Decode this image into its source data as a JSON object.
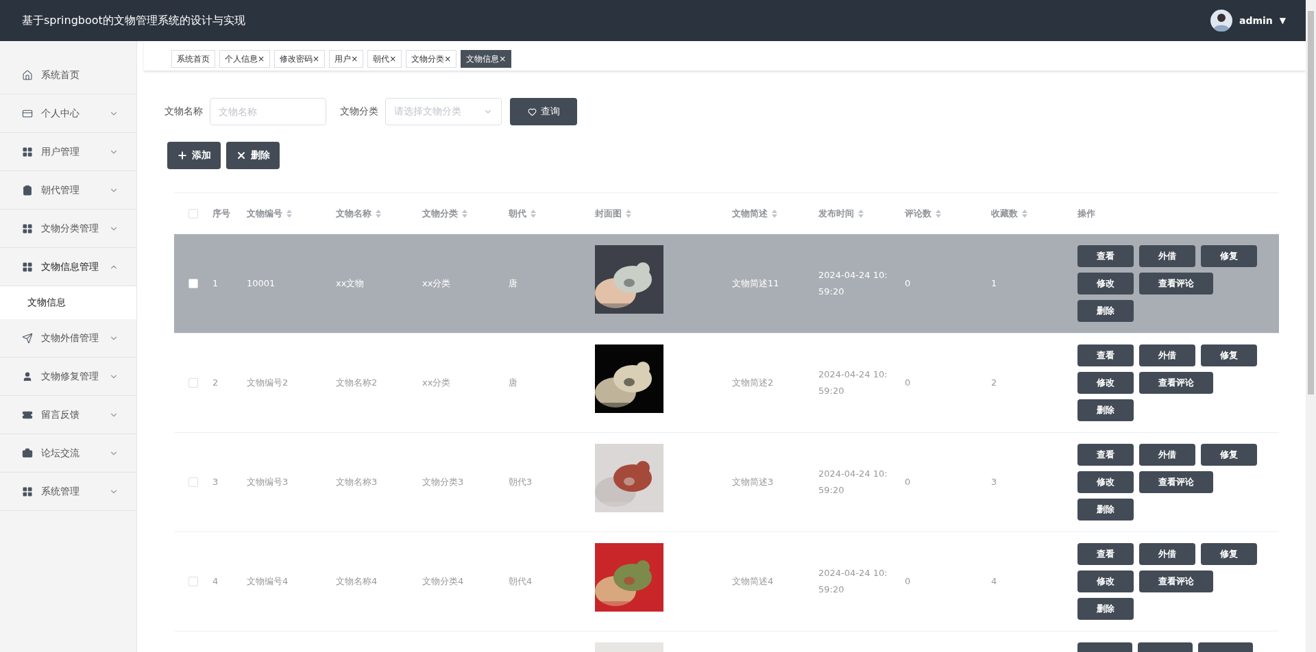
{
  "header": {
    "title": "基于springboot的文物管理系统的设计与实现",
    "user": "admin",
    "caret": "▼"
  },
  "sidebar": {
    "items": [
      {
        "label": "系统首页",
        "kind": "link"
      },
      {
        "label": "个人中心",
        "kind": "menu",
        "expanded": false
      },
      {
        "label": "用户管理",
        "kind": "menu",
        "expanded": false
      },
      {
        "label": "朝代管理",
        "kind": "menu",
        "expanded": false
      },
      {
        "label": "文物分类管理",
        "kind": "menu",
        "expanded": false
      },
      {
        "label": "文物信息管理",
        "kind": "menu",
        "expanded": true,
        "children": [
          {
            "label": "文物信息",
            "selected": true
          }
        ]
      },
      {
        "label": "文物外借管理",
        "kind": "menu",
        "expanded": false
      },
      {
        "label": "文物修复管理",
        "kind": "menu",
        "expanded": false
      },
      {
        "label": "留言反馈",
        "kind": "menu",
        "expanded": false
      },
      {
        "label": "论坛交流",
        "kind": "menu",
        "expanded": false
      },
      {
        "label": "系统管理",
        "kind": "menu",
        "expanded": false
      }
    ]
  },
  "tabs": [
    {
      "label": "系统首页",
      "selected": false
    },
    {
      "label": "个人信息",
      "close": "×",
      "selected": false
    },
    {
      "label": "修改密码",
      "close": "×",
      "selected": false
    },
    {
      "label": "用户",
      "close": "×",
      "selected": false
    },
    {
      "label": "朝代",
      "close": "×",
      "selected": false
    },
    {
      "label": "文物分类",
      "close": "×",
      "selected": false
    },
    {
      "label": "文物信息",
      "close": "×",
      "selected": true
    }
  ],
  "search": {
    "fields": [
      {
        "label": "文物名称",
        "kind": "text",
        "placeholder": "文物名称"
      },
      {
        "label": "文物分类",
        "kind": "select",
        "placeholder": "请选择文物分类"
      }
    ],
    "button": "查询"
  },
  "toolbar": [
    {
      "label": "添加",
      "kind": "add"
    },
    {
      "label": "删除",
      "kind": "delete"
    }
  ],
  "table": {
    "select_all": {
      "checked": false
    },
    "columns": [
      {
        "label": "序号",
        "sortable": false
      },
      {
        "label": "文物编号",
        "sortable": true
      },
      {
        "label": "文物名称",
        "sortable": true
      },
      {
        "label": "文物分类",
        "sortable": true
      },
      {
        "label": "朝代",
        "sortable": true
      },
      {
        "label": "封面图",
        "sortable": true
      },
      {
        "label": "文物简述",
        "sortable": true
      },
      {
        "label": "发布时间",
        "sortable": true
      },
      {
        "label": "评论数",
        "sortable": true
      },
      {
        "label": "收藏数",
        "sortable": true
      },
      {
        "label": "操作",
        "sortable": false
      }
    ],
    "rows": [
      {
        "selected": true,
        "checked": false,
        "cells": [
          "1",
          "10001",
          "xx文物",
          "xx分类",
          "唐"
        ],
        "cover": {
          "kind": "picture"
        },
        "details": [
          "文物简述11",
          "2024-04-24 10:59:20",
          "0",
          "1"
        ],
        "actions": [
          "查看",
          "外借",
          "修复",
          "修改",
          "查看评论",
          "删除"
        ]
      },
      {
        "selected": false,
        "checked": false,
        "cells": [
          "2",
          "文物编号2",
          "文物名称2",
          "xx分类",
          "唐"
        ],
        "cover": {
          "kind": "picture"
        },
        "details": [
          "文物简述2",
          "2024-04-24 10:59:20",
          "0",
          "2"
        ],
        "actions": [
          "查看",
          "外借",
          "修复",
          "修改",
          "查看评论",
          "删除"
        ]
      },
      {
        "selected": false,
        "checked": false,
        "cells": [
          "3",
          "文物编号3",
          "文物名称3",
          "文物分类3",
          "朝代3"
        ],
        "cover": {
          "kind": "picture"
        },
        "details": [
          "文物简述3",
          "2024-04-24 10:59:20",
          "0",
          "3"
        ],
        "actions": [
          "查看",
          "外借",
          "修复",
          "修改",
          "查看评论",
          "删除"
        ]
      },
      {
        "selected": false,
        "checked": false,
        "cells": [
          "4",
          "文物编号4",
          "文物名称4",
          "文物分类4",
          "朝代4"
        ],
        "cover": {
          "kind": "picture"
        },
        "details": [
          "文物简述4",
          "2024-04-24 10:59:20",
          "0",
          "4"
        ],
        "actions": [
          "查看",
          "外借",
          "修复",
          "修改",
          "查看评论",
          "删除"
        ]
      },
      {
        "selected": false,
        "cover": {
          "kind": "picture"
        },
        "cut_actions": [
          {
            "kind": "button"
          },
          {
            "kind": "button"
          },
          {
            "kind": "button"
          }
        ]
      }
    ]
  }
}
